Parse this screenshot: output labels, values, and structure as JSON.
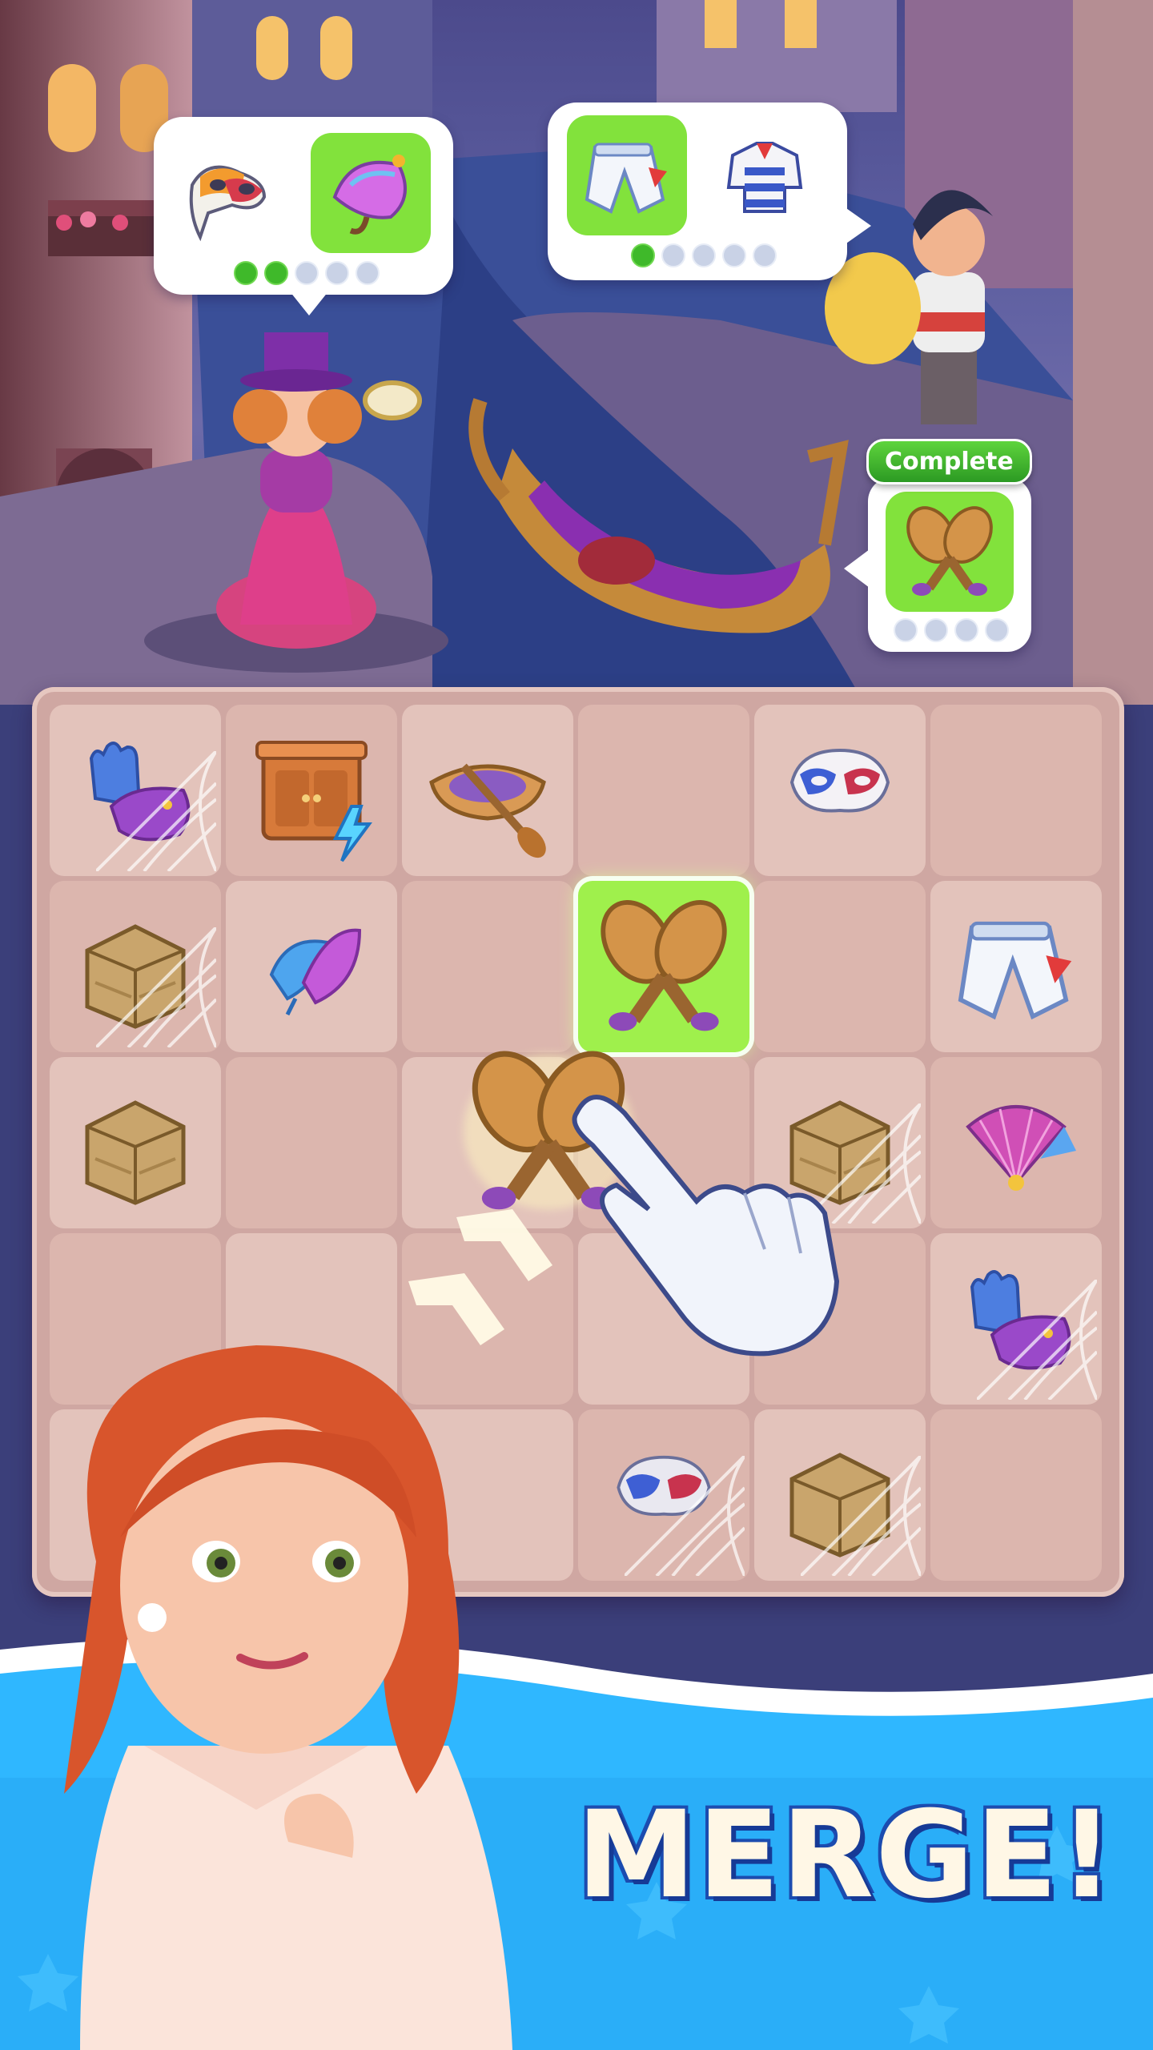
{
  "orders": [
    {
      "id": "order-1",
      "items": [
        "carnival-mask-icon",
        "parasol-icon"
      ],
      "ready": [
        false,
        true
      ],
      "progress_filled": 2,
      "progress_total": 5
    },
    {
      "id": "order-2",
      "items": [
        "white-pants-icon",
        "striped-shirt-icon"
      ],
      "ready": [
        true,
        false
      ],
      "progress_filled": 1,
      "progress_total": 5
    },
    {
      "id": "order-3",
      "items": [
        "oars-icon"
      ],
      "ready": [
        true
      ],
      "progress_filled": 0,
      "progress_total": 4,
      "status_label": "Complete"
    }
  ],
  "board": {
    "rows": 5,
    "cols": 6,
    "cells": [
      [
        "glove-purse-webbed",
        "cabinet-energy",
        "rowboat",
        "",
        "blue-red-mask",
        ""
      ],
      [
        "crate-webbed",
        "feather",
        "",
        "oars-highlight",
        "",
        "white-pants"
      ],
      [
        "crate",
        "",
        "oars-dragging",
        "",
        "crate-webbed",
        "fan"
      ],
      [
        "",
        "",
        "",
        "",
        "",
        "glove-purse-webbed"
      ],
      [
        "",
        "",
        "",
        "mask-webbed",
        "crate-webbed",
        ""
      ]
    ]
  },
  "banner": {
    "text": "MERGE!"
  },
  "colors": {
    "board": "#cfa7a2",
    "cell": "#e3c3bb",
    "highlight": "#9ff04c",
    "water": "#2fb7ff",
    "progress_on": "#3fb92a"
  }
}
